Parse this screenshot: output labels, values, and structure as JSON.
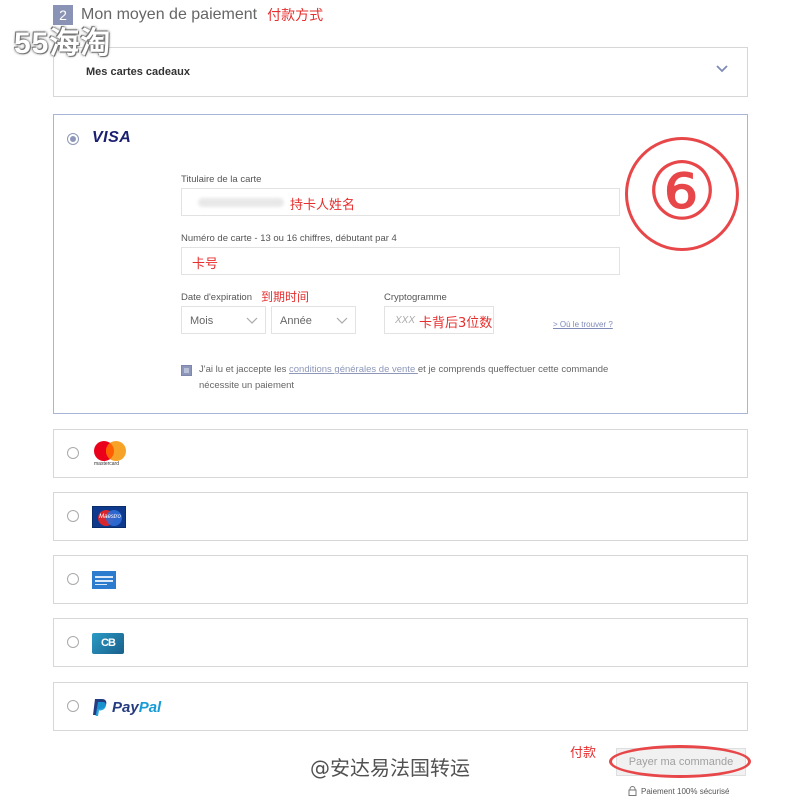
{
  "watermark": "55海淘",
  "step": {
    "number": "2",
    "title": "Mon moyen de paiement",
    "note": "付款方式"
  },
  "gift_cards": {
    "title": "Mes cartes cadeaux"
  },
  "visa": {
    "brand": "VISA",
    "holder": {
      "label": "Titulaire de la carte",
      "note": "持卡人姓名"
    },
    "number": {
      "label": "Numéro de carte - 13 ou 16 chiffres, débutant par 4",
      "note": "卡号"
    },
    "expiry": {
      "label": "Date d'expiration",
      "note": "到期时间",
      "month": "Mois",
      "year": "Année"
    },
    "cvv": {
      "label": "Cryptogramme",
      "placeholder": "XXX",
      "note": "卡背后3位数",
      "help": "> Où le trouver ?"
    },
    "terms": {
      "before": "J'ai lu et jaccepte les ",
      "link": "conditions générales de vente ",
      "after": "et je comprends queffectuer cette commande nécessite un paiement"
    }
  },
  "annotation_number": "⑥",
  "payment_methods": [
    {
      "name": "mastercard",
      "label": "mastercard"
    },
    {
      "name": "maestro",
      "label": "Maestro"
    },
    {
      "name": "amex",
      "label": ""
    },
    {
      "name": "cb",
      "label": "CB"
    },
    {
      "name": "paypal",
      "label": "PayPal",
      "label_prefix": "Pay",
      "label_suffix": "Pal"
    }
  ],
  "footer": {
    "share": "@安达易法国转运",
    "pay_note": "付款",
    "pay_button": "Payer ma commande",
    "secure": "Paiement 100% sécurisé"
  },
  "colors": {
    "accent": "#8e97b9",
    "annotation": "#e8474a",
    "visa": "#1a1f71",
    "paypal_dark": "#253b80",
    "paypal_light": "#179bd7"
  }
}
